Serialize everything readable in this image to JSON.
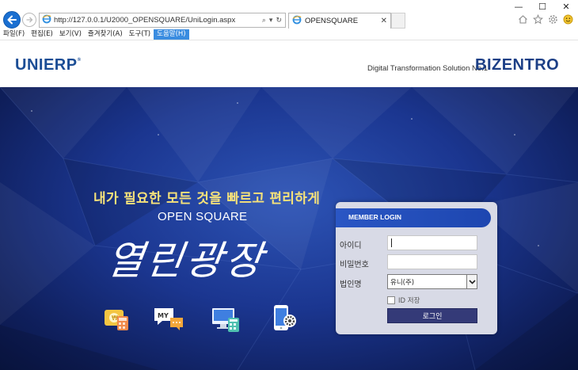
{
  "window": {
    "minimize_glyph": "—",
    "maximize_glyph": "☐",
    "close_glyph": "✕"
  },
  "address_bar": {
    "url": "http://127.0.0.1/U2000_OPENSQUARE/UniLogin.aspx",
    "search_glyph": "⌕",
    "dropdown_glyph": "▾",
    "refresh_glyph": "↻"
  },
  "tab": {
    "label": "OPENSQUARE",
    "close_glyph": "✕"
  },
  "menubar": {
    "items": [
      "파일(F)",
      "편집(E)",
      "보기(V)",
      "즐겨찾기(A)",
      "도구(T)",
      "도움말(H)"
    ]
  },
  "header": {
    "left_logo": "UNIERP",
    "left_logo_mark": "®",
    "tagline": "Digital Transformation Solution No.1",
    "right_logo": "BIZENTRO"
  },
  "hero": {
    "slogan": "내가 필요한 모든 것을 빠르고 편리하게",
    "product_name": "OPEN SQUARE",
    "brand_script": "열린광장"
  },
  "login": {
    "title": "MEMBER LOGIN",
    "id_label": "아이디",
    "id_value": "",
    "password_label": "비밀번호",
    "password_value": "",
    "company_label": "법인명",
    "company_selected": "유니(주)",
    "save_id_label": "ID 저장",
    "save_id_checked": false,
    "login_button": "로그인"
  },
  "colors": {
    "accent": "#1a6fd1",
    "login_header": "#2a56c4",
    "login_button": "#343a78",
    "slogan": "#f6e27a",
    "logo": "#1b4d95"
  }
}
